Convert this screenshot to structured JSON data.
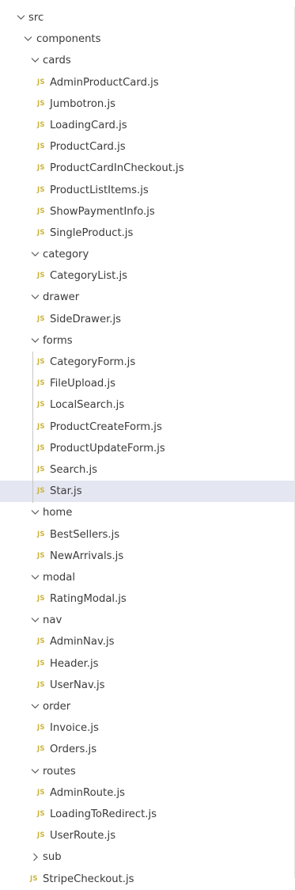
{
  "explorer": {
    "items": [
      {
        "label": "src",
        "kind": "folder",
        "expanded": true,
        "depth": 0
      },
      {
        "label": "components",
        "kind": "folder",
        "expanded": true,
        "depth": 1
      },
      {
        "label": "cards",
        "kind": "folder",
        "expanded": true,
        "depth": 2
      },
      {
        "label": "AdminProductCard.js",
        "kind": "file",
        "depth": 3
      },
      {
        "label": "Jumbotron.js",
        "kind": "file",
        "depth": 3
      },
      {
        "label": "LoadingCard.js",
        "kind": "file",
        "depth": 3
      },
      {
        "label": "ProductCard.js",
        "kind": "file",
        "depth": 3
      },
      {
        "label": "ProductCardInCheckout.js",
        "kind": "file",
        "depth": 3
      },
      {
        "label": "ProductListItems.js",
        "kind": "file",
        "depth": 3
      },
      {
        "label": "ShowPaymentInfo.js",
        "kind": "file",
        "depth": 3
      },
      {
        "label": "SingleProduct.js",
        "kind": "file",
        "depth": 3
      },
      {
        "label": "category",
        "kind": "folder",
        "expanded": true,
        "depth": 2
      },
      {
        "label": "CategoryList.js",
        "kind": "file",
        "depth": 3
      },
      {
        "label": "drawer",
        "kind": "folder",
        "expanded": true,
        "depth": 2
      },
      {
        "label": "SideDrawer.js",
        "kind": "file",
        "depth": 3
      },
      {
        "label": "forms",
        "kind": "folder",
        "expanded": true,
        "depth": 2
      },
      {
        "label": "CategoryForm.js",
        "kind": "file",
        "depth": 3
      },
      {
        "label": "FileUpload.js",
        "kind": "file",
        "depth": 3
      },
      {
        "label": "LocalSearch.js",
        "kind": "file",
        "depth": 3
      },
      {
        "label": "ProductCreateForm.js",
        "kind": "file",
        "depth": 3
      },
      {
        "label": "ProductUpdateForm.js",
        "kind": "file",
        "depth": 3
      },
      {
        "label": "Search.js",
        "kind": "file",
        "depth": 3
      },
      {
        "label": "Star.js",
        "kind": "file",
        "depth": 3,
        "selected": true
      },
      {
        "label": "home",
        "kind": "folder",
        "expanded": true,
        "depth": 2
      },
      {
        "label": "BestSellers.js",
        "kind": "file",
        "depth": 3
      },
      {
        "label": "NewArrivals.js",
        "kind": "file",
        "depth": 3
      },
      {
        "label": "modal",
        "kind": "folder",
        "expanded": true,
        "depth": 2
      },
      {
        "label": "RatingModal.js",
        "kind": "file",
        "depth": 3
      },
      {
        "label": "nav",
        "kind": "folder",
        "expanded": true,
        "depth": 2
      },
      {
        "label": "AdminNav.js",
        "kind": "file",
        "depth": 3
      },
      {
        "label": "Header.js",
        "kind": "file",
        "depth": 3
      },
      {
        "label": "UserNav.js",
        "kind": "file",
        "depth": 3
      },
      {
        "label": "order",
        "kind": "folder",
        "expanded": true,
        "depth": 2
      },
      {
        "label": "Invoice.js",
        "kind": "file",
        "depth": 3
      },
      {
        "label": "Orders.js",
        "kind": "file",
        "depth": 3
      },
      {
        "label": "routes",
        "kind": "folder",
        "expanded": true,
        "depth": 2
      },
      {
        "label": "AdminRoute.js",
        "kind": "file",
        "depth": 3
      },
      {
        "label": "LoadingToRedirect.js",
        "kind": "file",
        "depth": 3
      },
      {
        "label": "UserRoute.js",
        "kind": "file",
        "depth": 3
      },
      {
        "label": "sub",
        "kind": "folder",
        "expanded": false,
        "depth": 2
      },
      {
        "label": "StripeCheckout.js",
        "kind": "file",
        "depth": 2
      }
    ],
    "file_badge": "JS",
    "colors": {
      "text": "#3b3b3b",
      "js_badge": "#cbb43b",
      "selected_background": "#e4e6f1",
      "indent_guide": "#c6c6c6",
      "chevron": "#5a5a5a"
    }
  }
}
